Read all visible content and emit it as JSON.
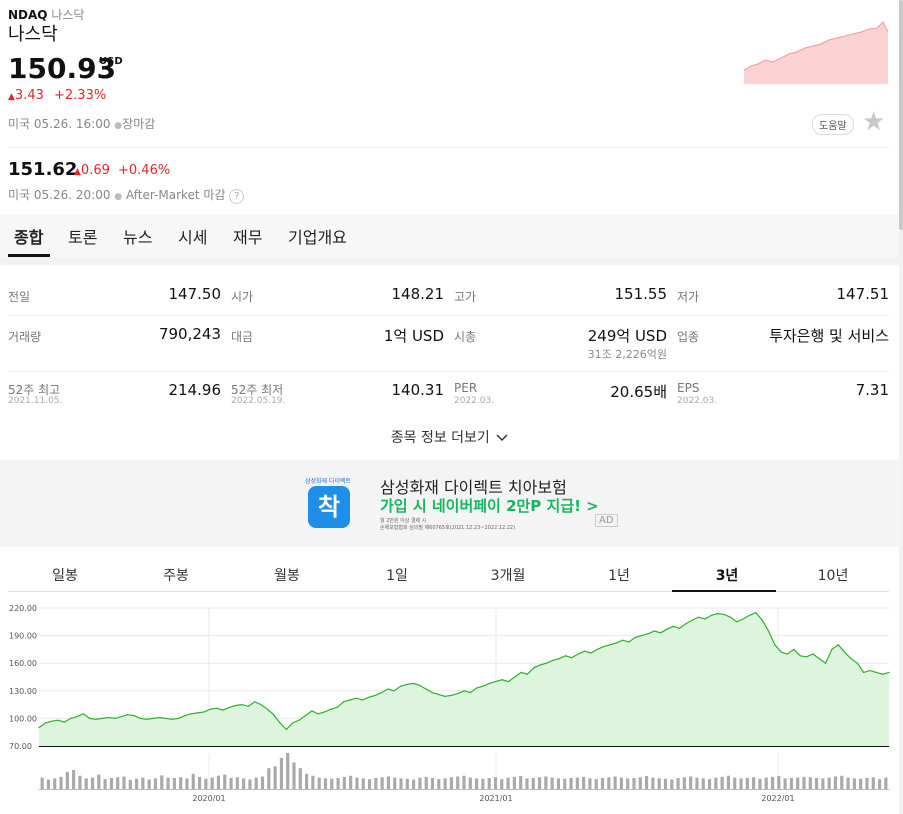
{
  "header": {
    "symbol": "NDAQ",
    "name_small": "나스닥",
    "name": "나스닥",
    "price": "150.93",
    "currency": "USD",
    "change": "3.43",
    "change_pct": "+2.33%",
    "market_time": "미국 05.26. 16:00",
    "market_status": "장마감",
    "help_label": "도움말",
    "after_price": "151.62",
    "after_change": "0.69",
    "after_change_pct": "+0.46%",
    "after_time": "미국 05.26. 20:00",
    "after_status": "After-Market 마감",
    "help_q": "?"
  },
  "tabs": [
    "종합",
    "토론",
    "뉴스",
    "시세",
    "재무",
    "기업개요"
  ],
  "stats": {
    "prev_label": "전일",
    "prev": "147.50",
    "open_label": "시가",
    "open": "148.21",
    "high_label": "고가",
    "high": "151.55",
    "low_label": "저가",
    "low": "147.51",
    "volume_label": "거래량",
    "volume": "790,243",
    "amount_label": "대금",
    "amount": "1억 USD",
    "mcap_label": "시총",
    "mcap": "249억 USD",
    "mcap_krw": "31조 2,226억원",
    "sector_label": "업종",
    "sector": "투자은행 및 서비스",
    "high52_label": "52주 최고",
    "high52_date": "2021.11.05.",
    "high52": "214.96",
    "low52_label": "52주 최저",
    "low52_date": "2022.05.19.",
    "low52": "140.31",
    "per_label": "PER",
    "per_date": "2022.03.",
    "per": "20.65배",
    "eps_label": "EPS",
    "eps_date": "2022.03.",
    "eps": "7.31",
    "more_label": "종목 정보 더보기"
  },
  "ad": {
    "brand_small": "삼성화재 다이렉트",
    "logo_char": "착",
    "title": "삼성화재 다이렉트 치아보험",
    "subtitle": "가입 시 네이버페이 2만P 지급! >",
    "fine1": "월 2만원 이상 결제 시",
    "fine2": "손해보험협회 심의필 제60765호(2021.12.23~2022.12.22)",
    "ad_badge": "AD"
  },
  "periods": [
    "일봉",
    "주봉",
    "월봉",
    "1일",
    "3개월",
    "1년",
    "3년",
    "10년"
  ],
  "active_period": "3년",
  "colors": {
    "red": "#e2252b",
    "green_line": "#2fb02f",
    "green_fill": "#dcf5dc",
    "accent": "#111111"
  },
  "chart_data": {
    "type": "area",
    "y_ticks": [
      "220.00",
      "190.00",
      "160.00",
      "130.00",
      "100.00",
      "70.00"
    ],
    "ylim": [
      70,
      220
    ],
    "x_ticks": [
      "2020/01",
      "2021/01",
      "2022/01"
    ],
    "values": [
      90,
      95,
      97,
      98,
      96,
      100,
      102,
      105,
      100,
      99,
      100,
      101,
      100,
      102,
      104,
      103,
      100,
      99,
      100,
      101,
      100,
      99,
      100,
      103,
      105,
      106,
      107,
      110,
      111,
      109,
      112,
      114,
      115,
      113,
      118,
      115,
      110,
      104,
      95,
      88,
      95,
      98,
      103,
      108,
      105,
      107,
      110,
      112,
      118,
      120,
      122,
      120,
      123,
      125,
      128,
      132,
      130,
      135,
      137,
      138,
      136,
      132,
      128,
      126,
      124,
      125,
      127,
      130,
      128,
      133,
      135,
      138,
      140,
      142,
      140,
      145,
      150,
      148,
      155,
      158,
      160,
      163,
      165,
      168,
      166,
      170,
      173,
      171,
      175,
      178,
      180,
      182,
      185,
      183,
      188,
      190,
      192,
      195,
      193,
      197,
      200,
      198,
      203,
      207,
      210,
      208,
      212,
      214,
      213,
      210,
      205,
      208,
      212,
      215,
      207,
      195,
      180,
      172,
      170,
      175,
      168,
      167,
      170,
      165,
      160,
      175,
      180,
      172,
      165,
      160,
      150,
      152,
      150,
      148,
      150
    ],
    "volume": [
      30,
      25,
      28,
      32,
      45,
      50,
      35,
      28,
      30,
      38,
      26,
      29,
      31,
      33,
      24,
      27,
      30,
      25,
      28,
      36,
      30,
      29,
      31,
      28,
      40,
      32,
      27,
      30,
      35,
      38,
      29,
      31,
      28,
      25,
      30,
      33,
      55,
      60,
      82,
      95,
      70,
      55,
      40,
      35,
      30,
      28,
      27,
      29,
      32,
      35,
      30,
      28,
      26,
      29,
      31,
      33,
      30,
      28,
      27,
      25,
      30,
      32,
      29,
      26,
      28,
      31,
      33,
      35,
      30,
      28,
      27,
      29,
      31,
      26,
      30,
      32,
      34,
      28,
      29,
      31,
      33,
      30,
      28,
      27,
      29,
      30,
      32,
      28,
      26,
      29,
      31,
      33,
      30,
      28,
      29,
      31,
      34,
      30,
      28,
      27,
      25,
      29,
      31,
      33,
      30,
      28,
      26,
      30,
      32,
      35,
      30,
      28,
      29,
      31,
      27,
      30,
      32,
      34,
      28,
      29,
      30,
      32,
      31,
      29,
      28,
      30,
      33,
      35,
      30,
      28,
      27,
      29,
      31,
      26,
      30
    ]
  }
}
